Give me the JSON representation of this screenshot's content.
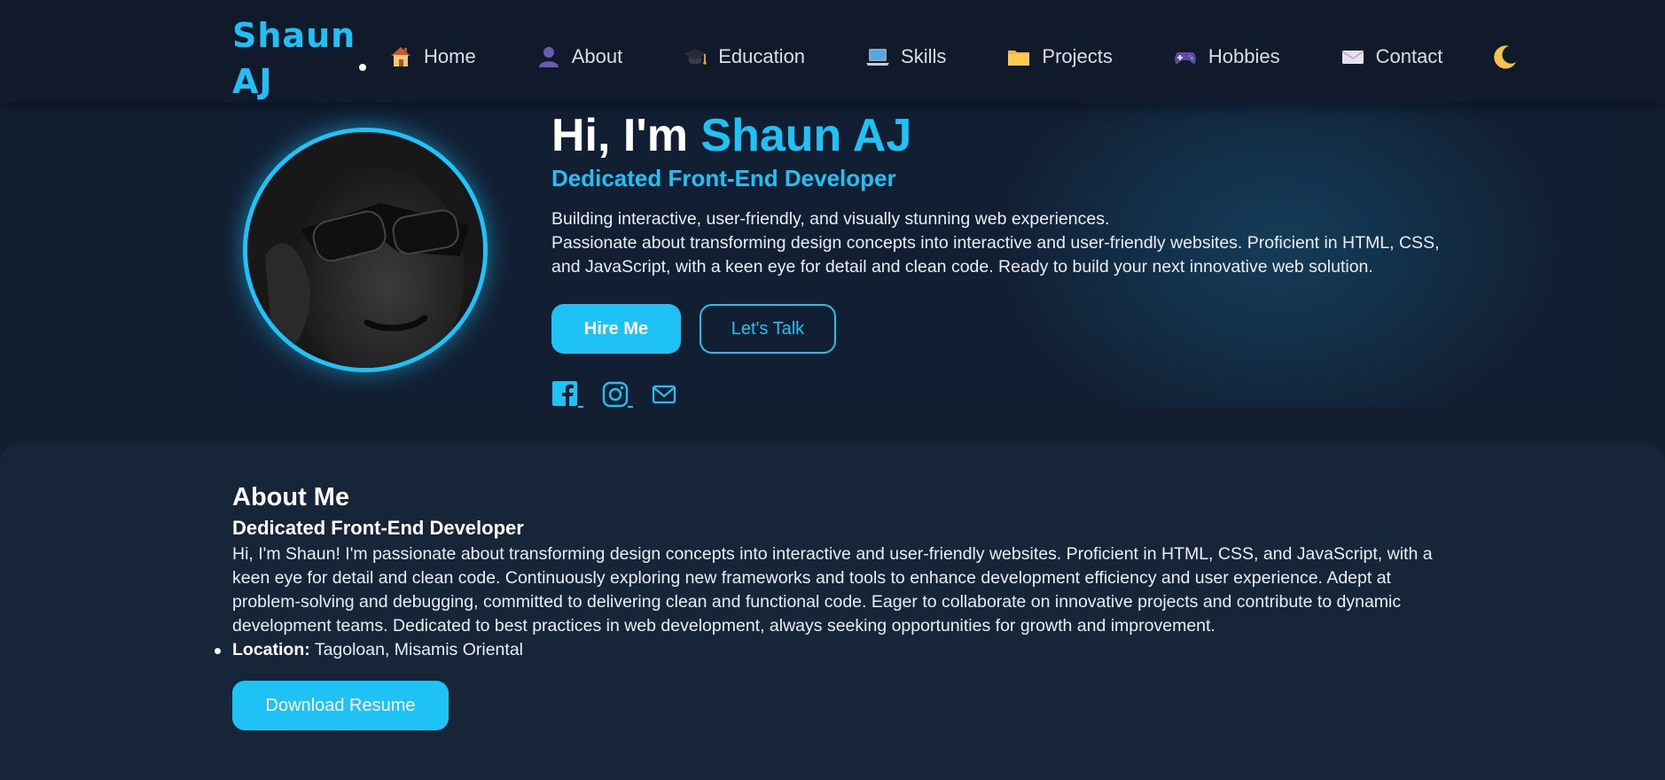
{
  "nav": {
    "logo": "Shaun AJ",
    "items": [
      {
        "label": "Home",
        "icon": "house-icon"
      },
      {
        "label": "About",
        "icon": "user-icon"
      },
      {
        "label": "Education",
        "icon": "graduation-cap-icon"
      },
      {
        "label": "Skills",
        "icon": "laptop-icon"
      },
      {
        "label": "Projects",
        "icon": "folder-icon"
      },
      {
        "label": "Hobbies",
        "icon": "gamepad-icon"
      },
      {
        "label": "Contact",
        "icon": "envelope-icon"
      }
    ],
    "theme_icon": "moon-icon"
  },
  "hero": {
    "greeting": "Hi, I'm ",
    "name": "Shaun AJ",
    "subtitle": "Dedicated Front-End Developer",
    "tagline": "Building interactive, user-friendly, and visually stunning web experiences.",
    "description": "Passionate about transforming design concepts into interactive and user-friendly websites. Proficient in HTML, CSS, and JavaScript, with a keen eye for detail and clean code. Ready to build your next innovative web solution.",
    "primary_button": "Hire Me",
    "secondary_button": "Let's Talk",
    "socials": [
      "facebook-icon",
      "instagram-icon",
      "email-icon"
    ]
  },
  "about": {
    "heading": "About Me",
    "subheading": "Dedicated Front-End Developer",
    "paragraph": "Hi, I'm Shaun! I'm passionate about transforming design concepts into interactive and user-friendly websites. Proficient in HTML, CSS, and JavaScript, with a keen eye for detail and clean code. Continuously exploring new frameworks and tools to enhance development efficiency and user experience. Adept at problem-solving and debugging, committed to delivering clean and functional code. Eager to collaborate on innovative projects and contribute to dynamic development teams. Dedicated to best practices in web development, always seeking opportunities for growth and improvement.",
    "location_label": "Location:",
    "location_value": " Tagoloan, Misamis Oriental",
    "download_button": "Download Resume"
  },
  "colors": {
    "accent": "#1fc2f5",
    "background": "#131e30",
    "nav_background": "#111a2a",
    "card_background": "#172538"
  }
}
